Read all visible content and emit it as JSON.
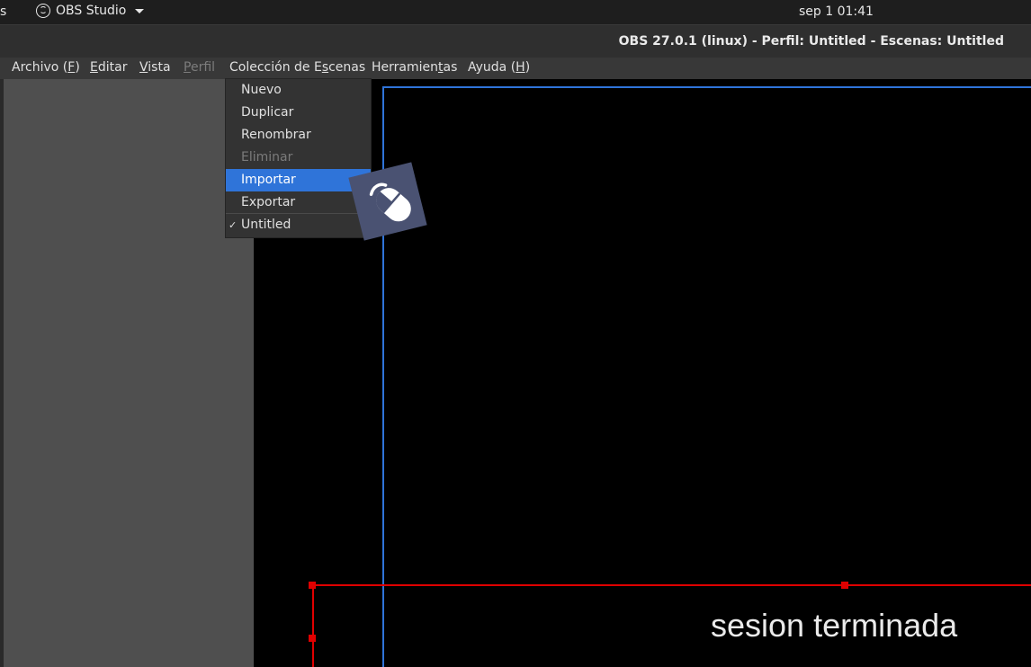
{
  "topbar": {
    "activities_fragment": "s",
    "app_name": "OBS Studio",
    "clock": "sep 1  01:41"
  },
  "window": {
    "title": "OBS 27.0.1 (linux) - Perfil: Untitled - Escenas: Untitled"
  },
  "menubar": {
    "items": [
      {
        "label": "Archivo (",
        "mnemonic": "F",
        "suffix": ")",
        "disabled": false
      },
      {
        "label": "",
        "mnemonic": "E",
        "suffix": "ditar",
        "disabled": false
      },
      {
        "label": "",
        "mnemonic": "V",
        "suffix": "ista",
        "disabled": false
      },
      {
        "label": "",
        "mnemonic": "P",
        "suffix": "erfil",
        "disabled": true
      },
      {
        "label": "Colección de E",
        "mnemonic": "s",
        "suffix": "cenas",
        "disabled": false
      },
      {
        "label": "Herramien",
        "mnemonic": "t",
        "suffix": "as",
        "disabled": false
      },
      {
        "label": "Ayuda (",
        "mnemonic": "H",
        "suffix": ")",
        "disabled": false
      }
    ]
  },
  "dropdown": {
    "items": [
      {
        "label": "Nuevo",
        "state": "normal"
      },
      {
        "label": "Duplicar",
        "state": "normal"
      },
      {
        "label": "Renombrar",
        "state": "normal"
      },
      {
        "label": "Eliminar",
        "state": "disabled"
      },
      {
        "label": "Importar",
        "state": "highlighted"
      },
      {
        "label": "Exportar",
        "state": "normal"
      },
      {
        "label": "Untitled",
        "state": "checked"
      }
    ],
    "check_glyph": "✓"
  },
  "preview": {
    "overlay_text": "sesion terminada"
  },
  "icons": {
    "app_icon": "obs-logo-icon",
    "dropdown_arrow": "caret-down-icon",
    "click_indicator": "mouse-left-click-icon"
  },
  "colors": {
    "highlight": "#2f74d9",
    "selection_red": "#e00000"
  }
}
